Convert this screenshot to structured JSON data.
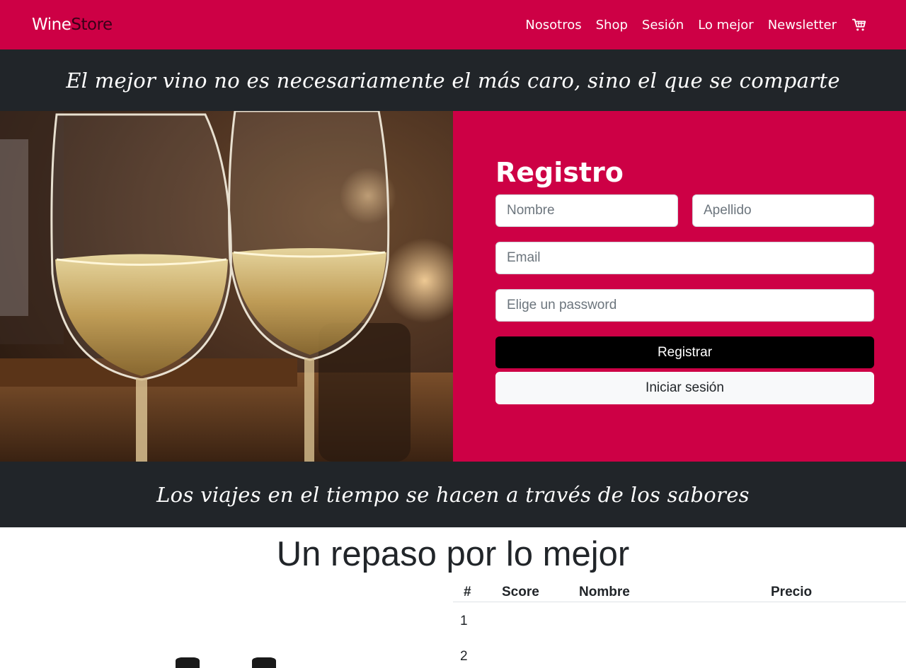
{
  "brand": {
    "part1": "Wine",
    "part2": "Store"
  },
  "nav": {
    "items": [
      "Nosotros",
      "Shop",
      "Sesión",
      "Lo mejor",
      "Newsletter"
    ]
  },
  "quotes": {
    "top": "El mejor vino no es necesariamente el más caro, sino el que se comparte",
    "bottom": "Los viajes en el tiempo se hacen a través de los sabores"
  },
  "register": {
    "title": "Registro",
    "nombre_placeholder": "Nombre",
    "apellido_placeholder": "Apellido",
    "email_placeholder": "Email",
    "password_placeholder": "Elige un password",
    "register_button": "Registrar",
    "login_button": "Iniciar sesión"
  },
  "best": {
    "title": "Un repaso por lo mejor",
    "columns": [
      "#",
      "Score",
      "Nombre",
      "Precio"
    ],
    "rows": [
      {
        "num": "1"
      },
      {
        "num": "2"
      }
    ]
  },
  "colors": {
    "brand": "#cd0045",
    "dark": "#212529"
  }
}
